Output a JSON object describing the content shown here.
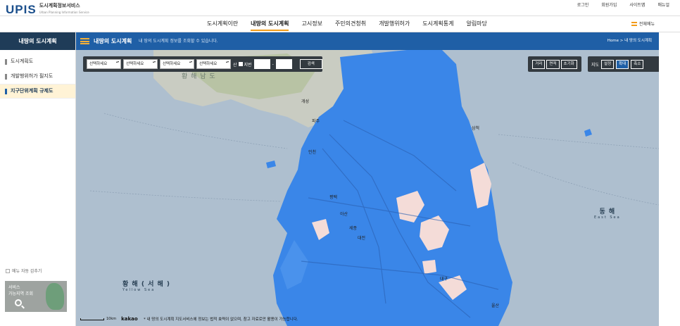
{
  "header": {
    "logo_mark": "UPIS",
    "logo_title": "도시계획정보서비스",
    "logo_subtitle": "Urban Planning Information Service",
    "util_links": [
      "로그인",
      "회원가입",
      "사이트맵",
      "매뉴얼"
    ]
  },
  "gnb": {
    "items": [
      "도시계획이란",
      "내땅의 도시계획",
      "고시정보",
      "주민의견청취",
      "개발행위허가",
      "도시계획통계",
      "알림마당"
    ],
    "active_index": 1,
    "all_menu": "전체메뉴"
  },
  "sidebar": {
    "title": "내땅의 도시계획",
    "items": [
      {
        "label": "도시계획도",
        "active": false
      },
      {
        "label": "개발행위허가 필지도",
        "active": false
      },
      {
        "label": "지구단위계획 규제도",
        "active": true
      }
    ],
    "auto_hide": "메뉴 자동 감추기",
    "service_box": {
      "line1": "서비스",
      "line2": "가능지역 조회"
    }
  },
  "page_header": {
    "title": "내땅의 도시계획",
    "description": "내 땅의 도시계획 정보를 조회할 수 있습니다.",
    "breadcrumb": "Home > 내 땅의 도시계획"
  },
  "filter": {
    "selects": [
      "선택하세요",
      "선택하세요",
      "선택하세요",
      "선택하세요"
    ],
    "mountain_label": "산",
    "lot_label": "지번",
    "lot_dash": "-",
    "search_button": "검색"
  },
  "measure": {
    "buttons": [
      "거리",
      "면적",
      "초기화"
    ]
  },
  "map_control": {
    "label": "지도",
    "buttons": [
      "설정",
      "확대",
      "축소"
    ],
    "active_index": 1
  },
  "map": {
    "seas": {
      "yellow_kr": "황 해 ( 서 해 )",
      "yellow_en": "Yellow Sea",
      "east_kr": "동 해",
      "east_en": "East Sea",
      "yellow_north_kr": "황 해 남 도"
    },
    "cities": [
      "개성",
      "파주",
      "인천",
      "세종",
      "대전",
      "대구",
      "울산",
      "평택",
      "삼척",
      "아산"
    ],
    "scale": "10km",
    "attribution": "kakao",
    "notice": "* 내 땅의 도시계획 지도서비스에 정보는 법적 효력이 없으며, 참고 자료로만 활용이 가능합니다."
  },
  "colors": {
    "header_dark": "#1f3c58",
    "header_blue": "#1f5fa6",
    "accent": "#f29b18",
    "plan_blue": "#3a86e8",
    "sea": "#aebfcf"
  }
}
